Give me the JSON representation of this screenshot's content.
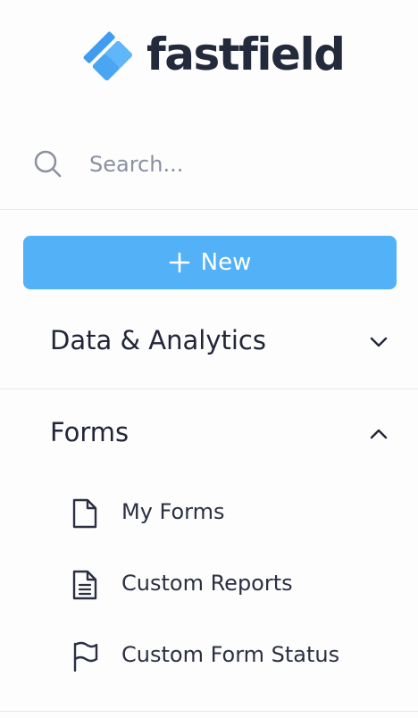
{
  "brand": {
    "name": "fastfield",
    "logo_icon": "fastfield-logo-icon",
    "accent_color": "#52b1f7",
    "text_color": "#232a3b"
  },
  "search": {
    "icon": "search-icon",
    "placeholder": "Search...",
    "value": ""
  },
  "new_button": {
    "icon": "plus-icon",
    "label": "New"
  },
  "nav": {
    "sections": [
      {
        "title": "Data & Analytics",
        "expanded": false,
        "icon": "chevron-down-icon"
      },
      {
        "title": "Forms",
        "expanded": true,
        "icon": "chevron-up-icon",
        "items": [
          {
            "label": "My Forms",
            "icon": "document-icon"
          },
          {
            "label": "Custom Reports",
            "icon": "report-icon"
          },
          {
            "label": "Custom Form Status",
            "icon": "flag-icon"
          }
        ]
      }
    ]
  }
}
